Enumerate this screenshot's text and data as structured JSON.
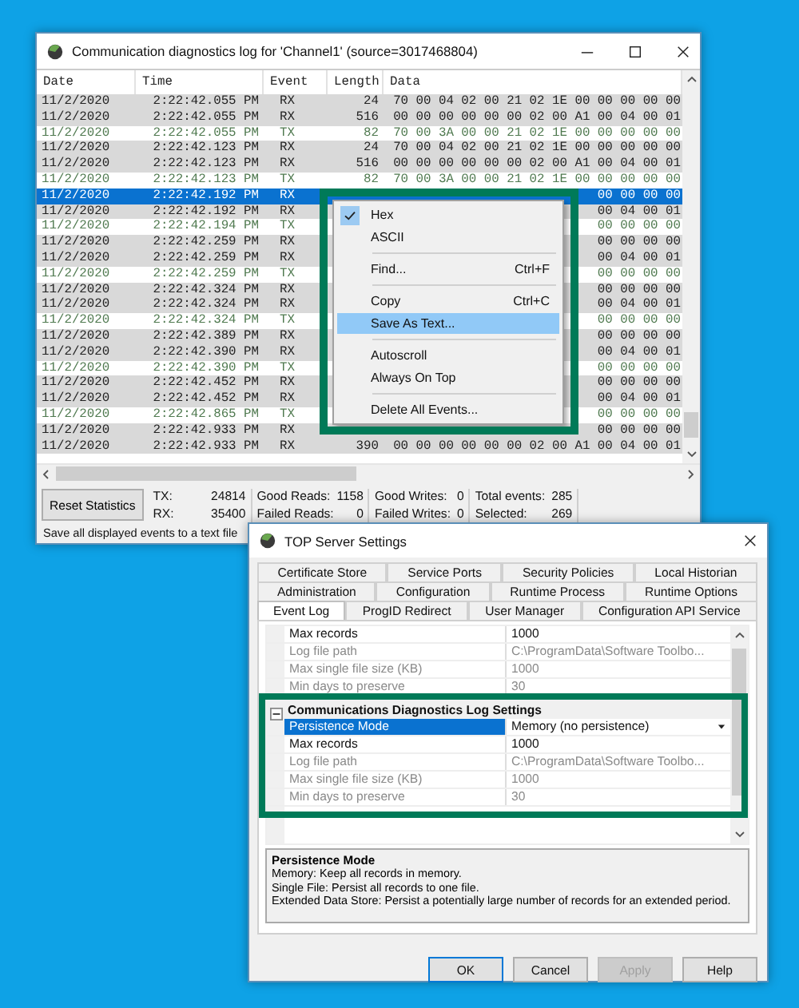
{
  "log_window": {
    "title": "Communication diagnostics log for 'Channel1' (source=3017468804)",
    "columns": [
      "Date",
      "Time",
      "Event",
      "Length",
      "Data"
    ],
    "rows": [
      {
        "date": "11/2/2020",
        "time": "2:22:42.055 PM",
        "event": "RX",
        "length": "24",
        "data": "70 00 04 02 00 21 02 1E 00 00 00 00 00",
        "kind": "rx",
        "selected": false
      },
      {
        "date": "11/2/2020",
        "time": "2:22:42.055 PM",
        "event": "RX",
        "length": "516",
        "data": "00 00 00 00 00 00 02 00 A1 00 04 00 01",
        "kind": "rx",
        "selected": false
      },
      {
        "date": "11/2/2020",
        "time": "2:22:42.055 PM",
        "event": "TX",
        "length": "82",
        "data": "70 00 3A 00 00 21 02 1E 00 00 00 00 00",
        "kind": "tx",
        "selected": false
      },
      {
        "date": "11/2/2020",
        "time": "2:22:42.123 PM",
        "event": "RX",
        "length": "24",
        "data": "70 00 04 02 00 21 02 1E 00 00 00 00 00",
        "kind": "rx",
        "selected": false
      },
      {
        "date": "11/2/2020",
        "time": "2:22:42.123 PM",
        "event": "RX",
        "length": "516",
        "data": "00 00 00 00 00 00 02 00 A1 00 04 00 01",
        "kind": "rx",
        "selected": false
      },
      {
        "date": "11/2/2020",
        "time": "2:22:42.123 PM",
        "event": "TX",
        "length": "82",
        "data": "70 00 3A 00 00 21 02 1E 00 00 00 00 00",
        "kind": "tx",
        "selected": false
      },
      {
        "date": "11/2/2020",
        "time": "2:22:42.192 PM",
        "event": "RX",
        "data": "00 00 00 00",
        "kind": "rx",
        "selected": true
      },
      {
        "date": "11/2/2020",
        "time": "2:22:42.192 PM",
        "event": "RX",
        "data": "00 04 00 01",
        "kind": "rx",
        "selected": false
      },
      {
        "date": "11/2/2020",
        "time": "2:22:42.194 PM",
        "event": "TX",
        "data": "00 00 00 00",
        "kind": "tx",
        "selected": false
      },
      {
        "date": "11/2/2020",
        "time": "2:22:42.259 PM",
        "event": "RX",
        "data": "00 00 00 00",
        "kind": "rx",
        "selected": false
      },
      {
        "date": "11/2/2020",
        "time": "2:22:42.259 PM",
        "event": "RX",
        "data": "00 04 00 01",
        "kind": "rx",
        "selected": false
      },
      {
        "date": "11/2/2020",
        "time": "2:22:42.259 PM",
        "event": "TX",
        "data": "00 00 00 00",
        "kind": "tx",
        "selected": false
      },
      {
        "date": "11/2/2020",
        "time": "2:22:42.324 PM",
        "event": "RX",
        "data": "00 00 00 00",
        "kind": "rx",
        "selected": false
      },
      {
        "date": "11/2/2020",
        "time": "2:22:42.324 PM",
        "event": "RX",
        "data": "00 04 00 01",
        "kind": "rx",
        "selected": false
      },
      {
        "date": "11/2/2020",
        "time": "2:22:42.324 PM",
        "event": "TX",
        "data": "00 00 00 00",
        "kind": "tx",
        "selected": false
      },
      {
        "date": "11/2/2020",
        "time": "2:22:42.389 PM",
        "event": "RX",
        "data": "00 00 00 00",
        "kind": "rx",
        "selected": false
      },
      {
        "date": "11/2/2020",
        "time": "2:22:42.390 PM",
        "event": "RX",
        "data": "00 04 00 01",
        "kind": "rx",
        "selected": false
      },
      {
        "date": "11/2/2020",
        "time": "2:22:42.390 PM",
        "event": "TX",
        "data": "00 00 00 00",
        "kind": "tx",
        "selected": false
      },
      {
        "date": "11/2/2020",
        "time": "2:22:42.452 PM",
        "event": "RX",
        "data": "00 00 00 00",
        "kind": "rx",
        "selected": false
      },
      {
        "date": "11/2/2020",
        "time": "2:22:42.452 PM",
        "event": "RX",
        "data": "00 04 00 01",
        "kind": "rx",
        "selected": false
      },
      {
        "date": "11/2/2020",
        "time": "2:22:42.865 PM",
        "event": "TX",
        "data": "00 00 00 00",
        "kind": "tx",
        "selected": false
      },
      {
        "date": "11/2/2020",
        "time": "2:22:42.933 PM",
        "event": "RX",
        "data": "00 00 00 00",
        "kind": "rx",
        "selected": false
      },
      {
        "date": "11/2/2020",
        "time": "2:22:42.933 PM",
        "event": "RX",
        "length": "390",
        "data": "00 00 00 00 00 00 02 00 A1 00 04 00 01",
        "kind": "rx",
        "selected": false
      }
    ],
    "context_menu": {
      "items": [
        {
          "kind": "item",
          "label": "Hex",
          "checked": true,
          "selected": false
        },
        {
          "kind": "item",
          "label": "ASCII",
          "checked": false,
          "selected": false
        },
        {
          "kind": "separator"
        },
        {
          "kind": "item",
          "label": "Find...",
          "shortcut": "Ctrl+F",
          "checked": false,
          "selected": false
        },
        {
          "kind": "separator"
        },
        {
          "kind": "item",
          "label": "Copy",
          "shortcut": "Ctrl+C",
          "checked": false,
          "selected": false
        },
        {
          "kind": "item",
          "label": "Save As Text...",
          "checked": false,
          "selected": true
        },
        {
          "kind": "separator"
        },
        {
          "kind": "item",
          "label": "Autoscroll",
          "checked": false,
          "selected": false
        },
        {
          "kind": "item",
          "label": "Always On Top",
          "checked": false,
          "selected": false
        },
        {
          "kind": "separator"
        },
        {
          "kind": "item",
          "label": "Delete All Events...",
          "checked": false,
          "selected": false
        }
      ]
    },
    "reset_button": "Reset Statistics",
    "stat_groups": [
      [
        {
          "label": "TX:",
          "value": "24814"
        },
        {
          "label": "RX:",
          "value": "35400"
        }
      ],
      [
        {
          "label": "Good Reads:",
          "value": "1158"
        },
        {
          "label": "Failed Reads:",
          "value": "0"
        }
      ],
      [
        {
          "label": "Good Writes:",
          "value": "0"
        },
        {
          "label": "Failed Writes:",
          "value": "0"
        }
      ],
      [
        {
          "label": "Total events:",
          "value": "285"
        },
        {
          "label": "Selected:",
          "value": "269"
        }
      ]
    ],
    "status_text": "Save all displayed events to a text file"
  },
  "settings_window": {
    "title": "TOP Server Settings",
    "tab_rows": [
      [
        {
          "label": "Certificate Store",
          "selected": false
        },
        {
          "label": "Service Ports",
          "selected": false
        },
        {
          "label": "Security Policies",
          "selected": false
        },
        {
          "label": "Local Historian",
          "selected": false
        }
      ],
      [
        {
          "label": "Administration",
          "selected": false
        },
        {
          "label": "Configuration",
          "selected": false
        },
        {
          "label": "Runtime Process",
          "selected": false
        },
        {
          "label": "Runtime Options",
          "selected": false
        }
      ],
      [
        {
          "label": "Event Log",
          "selected": true
        },
        {
          "label": "ProgID Redirect",
          "selected": false
        },
        {
          "label": "User Manager",
          "selected": false
        },
        {
          "label": "Configuration API Service",
          "selected": false
        }
      ]
    ],
    "property_grid": {
      "rows": [
        {
          "label": "Max records",
          "value": "1000",
          "kind": "text",
          "disabled": false,
          "selected": false
        },
        {
          "label": "Log file path",
          "value": "C:\\ProgramData\\Software Toolbo...",
          "kind": "text",
          "disabled": true,
          "selected": false
        },
        {
          "label": "Max single file size (KB)",
          "value": "1000",
          "kind": "text",
          "disabled": true,
          "selected": false
        },
        {
          "label": "Min days to preserve",
          "value": "30",
          "kind": "text",
          "disabled": true,
          "selected": false
        }
      ],
      "categories": [
        {
          "title": "Communications Diagnostics Log Settings",
          "expanded": true,
          "rows": [
            {
              "label": "Persistence Mode",
              "value": "Memory (no persistence)",
              "kind": "dropdown",
              "disabled": false,
              "selected": true
            },
            {
              "label": "Max records",
              "value": "1000",
              "kind": "text",
              "disabled": false,
              "selected": false
            },
            {
              "label": "Log file path",
              "value": "C:\\ProgramData\\Software Toolbo...",
              "kind": "text",
              "disabled": true,
              "selected": false
            },
            {
              "label": "Max single file size (KB)",
              "value": "1000",
              "kind": "text",
              "disabled": true,
              "selected": false
            },
            {
              "label": "Min days to preserve",
              "value": "30",
              "kind": "text",
              "disabled": true,
              "selected": false
            }
          ]
        }
      ]
    },
    "description": {
      "title": "Persistence Mode",
      "lines": [
        "Memory: Keep all records in memory.",
        "Single File: Persist all records to one file.",
        "Extended Data Store: Persist a potentially large number of records for an extended period."
      ]
    },
    "buttons": [
      {
        "label": "OK",
        "default": true,
        "disabled": false
      },
      {
        "label": "Cancel",
        "default": false,
        "disabled": false
      },
      {
        "label": "Apply",
        "default": false,
        "disabled": true
      },
      {
        "label": "Help",
        "default": false,
        "disabled": false
      }
    ]
  }
}
